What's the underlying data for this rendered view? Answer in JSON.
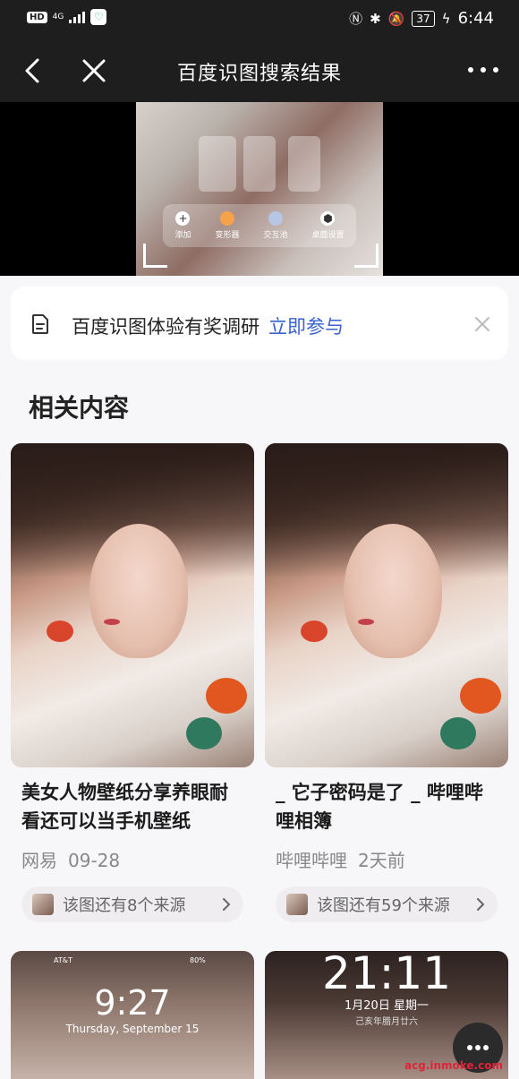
{
  "status_bar": {
    "hd": "HD",
    "network": "4G",
    "battery": "37",
    "time": "6:44",
    "icons": [
      "nfc-icon",
      "bluetooth-icon",
      "mute-icon",
      "charging-icon"
    ]
  },
  "header": {
    "title": "百度识图搜索结果",
    "back_icon": "chevron-left-icon",
    "close_icon": "close-icon",
    "more_icon": "more-dots-icon"
  },
  "preview": {
    "dock_items": [
      "添加",
      "变形器",
      "交互池",
      "桌面设置"
    ]
  },
  "survey": {
    "text": "百度识图体验有奖调研",
    "link": "立即参与"
  },
  "section_title": "相关内容",
  "cards": [
    {
      "title": "美女人物壁纸分享养眼耐看还可以当手机壁纸",
      "source": "网易",
      "date": "09-28",
      "sources_label": "该图还有8个来源"
    },
    {
      "title": "_ 它子密码是了 _ 哔哩哔哩相簿",
      "source": "哔哩哔哩",
      "date": "2天前",
      "sources_label": "该图还有59个来源"
    }
  ],
  "lower_cards": [
    {
      "time": "9:27",
      "date": "Thursday, September 15",
      "carrier": "AT&T",
      "battery": "80%"
    },
    {
      "time": "21:11",
      "date": "1月20日 星期一",
      "lunar": "己亥年腊月廿六"
    }
  ],
  "footer_watermark": "acg.inmoke.com",
  "colors": {
    "link": "#3a62d1",
    "header_bg": "#1e1e1e",
    "page_bg": "#f7f6f8"
  }
}
